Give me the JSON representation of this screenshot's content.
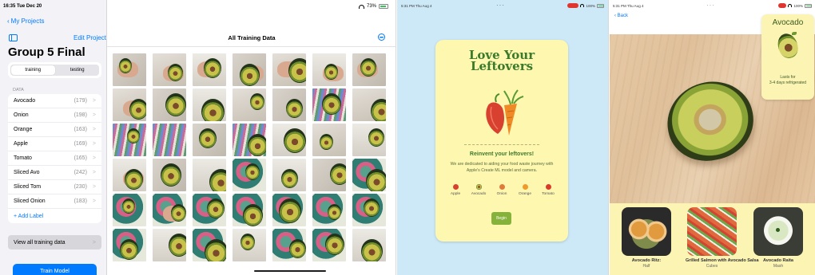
{
  "createml": {
    "status_time": "16:35  Tue Dec 20",
    "battery": "73%",
    "back_label": "My Projects",
    "edit_label": "Edit Project",
    "project_title": "Group 5 Final",
    "segments": [
      "training",
      "testing"
    ],
    "data_header": "DATA",
    "labels": [
      {
        "name": "Avocado",
        "count": "(179)"
      },
      {
        "name": "Onion",
        "count": "(198)"
      },
      {
        "name": "Orange",
        "count": "(163)"
      },
      {
        "name": "Apple",
        "count": "(169)"
      },
      {
        "name": "Tomato",
        "count": "(165)"
      },
      {
        "name": "Sliced Avo",
        "count": "(242)"
      },
      {
        "name": "Sliced Tom",
        "count": "(230)"
      },
      {
        "name": "Sliced Onion",
        "count": "(183)"
      }
    ],
    "add_label": "+ Add Label",
    "view_all": "View all training data",
    "train_button": "Train Model",
    "grid_title": "All Training Data",
    "chevron": ">"
  },
  "leftovers": {
    "status_time": "5:31 PM  Thu Aug 4",
    "status_battery": "100%",
    "headline_line1": "Love Your",
    "headline_line2": "Leftovers",
    "subtitle": "Reinvent your leftovers!",
    "body": "We are dedicated to aiding your food waste journey with Apple's Create ML model and camera.",
    "fruits": [
      {
        "label": "Apple",
        "color": "#d8402f"
      },
      {
        "label": "Avocado",
        "color": "#6f8d2c"
      },
      {
        "label": "Onion",
        "color": "#e07a3a"
      },
      {
        "label": "Orange",
        "color": "#f09a2a"
      },
      {
        "label": "Tomato",
        "color": "#d93a2b"
      }
    ],
    "begin_button": "Begin"
  },
  "avocado": {
    "status_time": "5:31 PM  Thu Aug 4",
    "status_battery": "100%",
    "back_label": "Back",
    "card_title": "Avocado",
    "card_note_line1": "Lasts for",
    "card_note_line2": "3-4 days refrigerated",
    "recipes": [
      {
        "name": "Avocado Ritz:",
        "cut": "Half"
      },
      {
        "name": "Grilled Salmon with Avocado Salsa",
        "cut": "Cubes"
      },
      {
        "name": "Avocado Raita",
        "cut": "Mash"
      }
    ]
  }
}
